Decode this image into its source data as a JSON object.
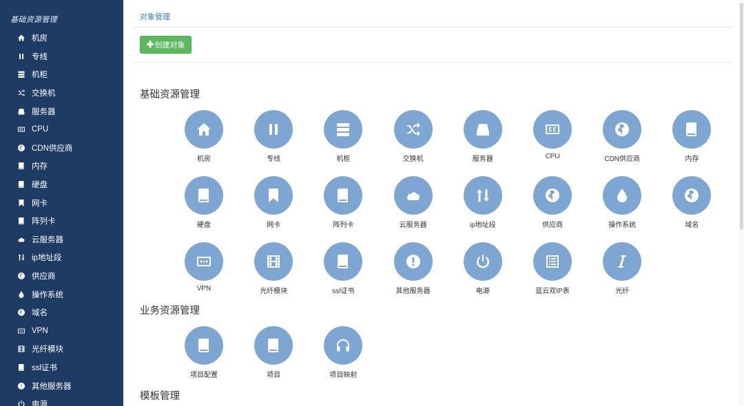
{
  "sidebar": {
    "title": "基础资源管理",
    "items": [
      {
        "label": "机房",
        "icon": "home-icon"
      },
      {
        "label": "专线",
        "icon": "pause-icon"
      },
      {
        "label": "机柜",
        "icon": "server-rack-icon"
      },
      {
        "label": "交换机",
        "icon": "shuffle-icon"
      },
      {
        "label": "服务器",
        "icon": "hdd-icon"
      },
      {
        "label": "CPU",
        "icon": "cc-icon"
      },
      {
        "label": "CDN供应商",
        "icon": "globe-icon"
      },
      {
        "label": "内存",
        "icon": "book-icon"
      },
      {
        "label": "硬盘",
        "icon": "book-icon"
      },
      {
        "label": "网卡",
        "icon": "bookmark-icon"
      },
      {
        "label": "阵列卡",
        "icon": "book-icon"
      },
      {
        "label": "云服务器",
        "icon": "cloud-icon"
      },
      {
        "label": "ip地址段",
        "icon": "sort-arrows-icon"
      },
      {
        "label": "供应商",
        "icon": "globe-icon"
      },
      {
        "label": "操作系统",
        "icon": "drop-icon"
      },
      {
        "label": "域名",
        "icon": "globe-icon"
      },
      {
        "label": "VPN",
        "icon": "vpn-icon"
      },
      {
        "label": "光纤模块",
        "icon": "film-icon"
      },
      {
        "label": "ssl证书",
        "icon": "book-icon"
      },
      {
        "label": "其他服务器",
        "icon": "exclamation-icon"
      },
      {
        "label": "电源",
        "icon": "power-icon"
      }
    ]
  },
  "header": {
    "breadcrumb": "对象管理"
  },
  "toolbar": {
    "create_label": "创建对象"
  },
  "sections": {
    "basic": {
      "title": "基础资源管理",
      "tiles": [
        {
          "label": "机房",
          "icon": "home-icon"
        },
        {
          "label": "专线",
          "icon": "pause-icon"
        },
        {
          "label": "机柜",
          "icon": "server-rack-icon"
        },
        {
          "label": "交换机",
          "icon": "shuffle-icon"
        },
        {
          "label": "服务器",
          "icon": "hdd-icon"
        },
        {
          "label": "CPU",
          "icon": "cc-icon"
        },
        {
          "label": "CDN供应商",
          "icon": "globe-icon"
        },
        {
          "label": "内存",
          "icon": "book-icon"
        },
        {
          "label": "硬盘",
          "icon": "book-icon"
        },
        {
          "label": "网卡",
          "icon": "bookmark-icon"
        },
        {
          "label": "阵列卡",
          "icon": "book-icon"
        },
        {
          "label": "云服务器",
          "icon": "cloud-icon"
        },
        {
          "label": "ip地址段",
          "icon": "sort-arrows-icon"
        },
        {
          "label": "供应商",
          "icon": "globe-icon"
        },
        {
          "label": "操作系统",
          "icon": "drop-icon"
        },
        {
          "label": "域名",
          "icon": "globe-icon"
        },
        {
          "label": "VPN",
          "icon": "vpn-icon"
        },
        {
          "label": "光纤模块",
          "icon": "film-icon"
        },
        {
          "label": "ssl证书",
          "icon": "book-icon"
        },
        {
          "label": "其他服务器",
          "icon": "exclamation-icon"
        },
        {
          "label": "电源",
          "icon": "power-icon"
        },
        {
          "label": "蓝云双IP表",
          "icon": "list-icon"
        },
        {
          "label": "光纤",
          "icon": "italic-icon"
        }
      ]
    },
    "business": {
      "title": "业务资源管理",
      "tiles": [
        {
          "label": "项目配置",
          "icon": "book-icon"
        },
        {
          "label": "项目",
          "icon": "book-icon"
        },
        {
          "label": "项目映射",
          "icon": "headphones-icon"
        }
      ]
    },
    "template": {
      "title": "模板管理"
    }
  },
  "colors": {
    "sidebar_bg": "#1e3b63",
    "tile_circle": "#7da6d3",
    "create_button": "#5cb85c",
    "breadcrumb_link": "#337ab7"
  }
}
